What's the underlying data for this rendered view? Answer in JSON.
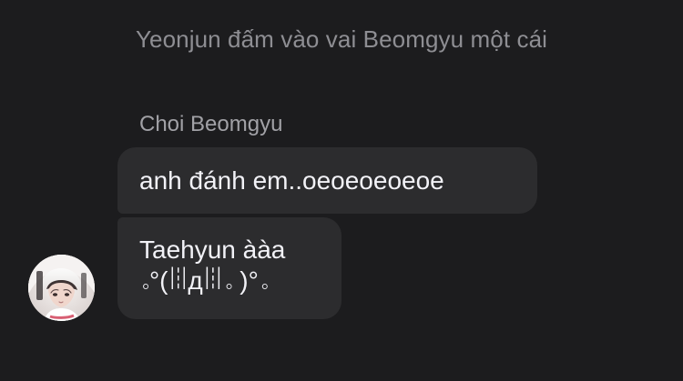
{
  "chat": {
    "action_text": "Yeonjun đấm vào vai Beomgyu một cái",
    "sender_name": "Choi Beomgyu",
    "messages": [
      {
        "text": "anh đánh em..oeoeoeoeoe"
      },
      {
        "line_1": "Taehyun ààa",
        "line_2": "｡°(ꈨдꈨ｡ )°｡"
      }
    ]
  },
  "colors": {
    "background": "#1c1c1e",
    "bubble": "#2c2c2e",
    "primary_text": "#f2f2f7",
    "secondary_text": "#8e8e93"
  }
}
